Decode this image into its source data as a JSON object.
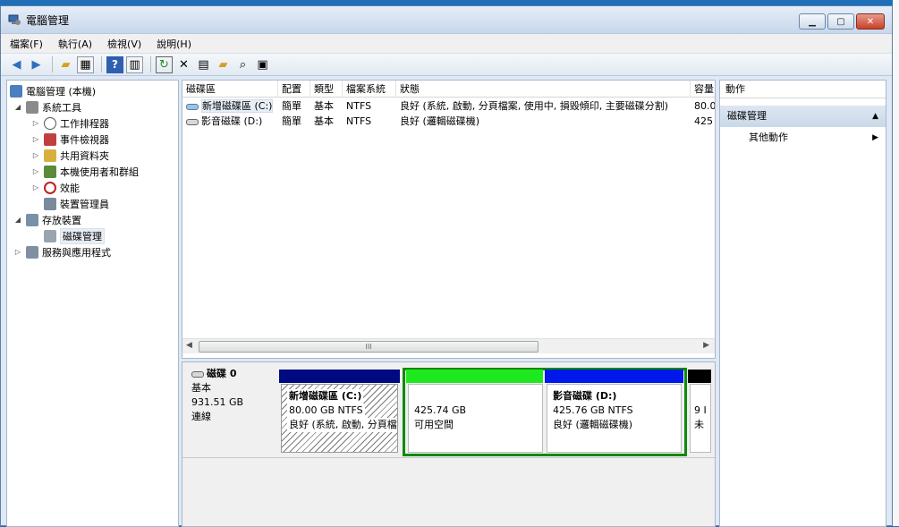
{
  "window": {
    "title": "電腦管理"
  },
  "menu": [
    "檔案(F)",
    "執行(A)",
    "檢視(V)",
    "說明(H)"
  ],
  "tree": {
    "root": "電腦管理 (本機)",
    "system_tools": "系統工具",
    "task_scheduler": "工作排程器",
    "event_viewer": "事件檢視器",
    "shared_folders": "共用資料夾",
    "local_users": "本機使用者和群組",
    "performance": "效能",
    "device_manager": "裝置管理員",
    "storage": "存放裝置",
    "disk_management": "磁碟管理",
    "services": "服務與應用程式"
  },
  "list": {
    "columns": [
      "磁碟區",
      "配置",
      "類型",
      "檔案系統",
      "狀態",
      "容量"
    ],
    "rows": [
      {
        "name": "新增磁碟區 (C:)",
        "layout": "簡單",
        "type": "基本",
        "fs": "NTFS",
        "status": "良好 (系統, 啟動, 分頁檔案, 使用中, 損毀傾印, 主要磁碟分割)",
        "capacity": "80.0"
      },
      {
        "name": "影音磁碟 (D:)",
        "layout": "簡單",
        "type": "基本",
        "fs": "NTFS",
        "status": "良好 (邏輯磁碟機)",
        "capacity": "425"
      }
    ],
    "scroll_thumb": "III"
  },
  "disk": {
    "name": "磁碟 0",
    "type": "基本",
    "size": "931.51 GB",
    "state": "連線",
    "partitions": [
      {
        "title": "新增磁碟區 (C:)",
        "size": "80.00 GB NTFS",
        "status": "良好 (系統, 啟動, 分頁檔"
      },
      {
        "size": "425.74 GB",
        "status": "可用空間"
      },
      {
        "title": "影音磁碟 (D:)",
        "size": "425.76 GB NTFS",
        "status": "良好 (邏輯磁碟機)"
      },
      {
        "size": "9 I",
        "status": "未"
      }
    ],
    "colors": {
      "primary": "#000a80",
      "free": "#1ee91e",
      "logical": "#0018ea",
      "unalloc": "#000000",
      "extended": "#0f8a0f"
    }
  },
  "actions": {
    "header": "動作",
    "section": "磁碟管理",
    "more": "其他動作"
  }
}
